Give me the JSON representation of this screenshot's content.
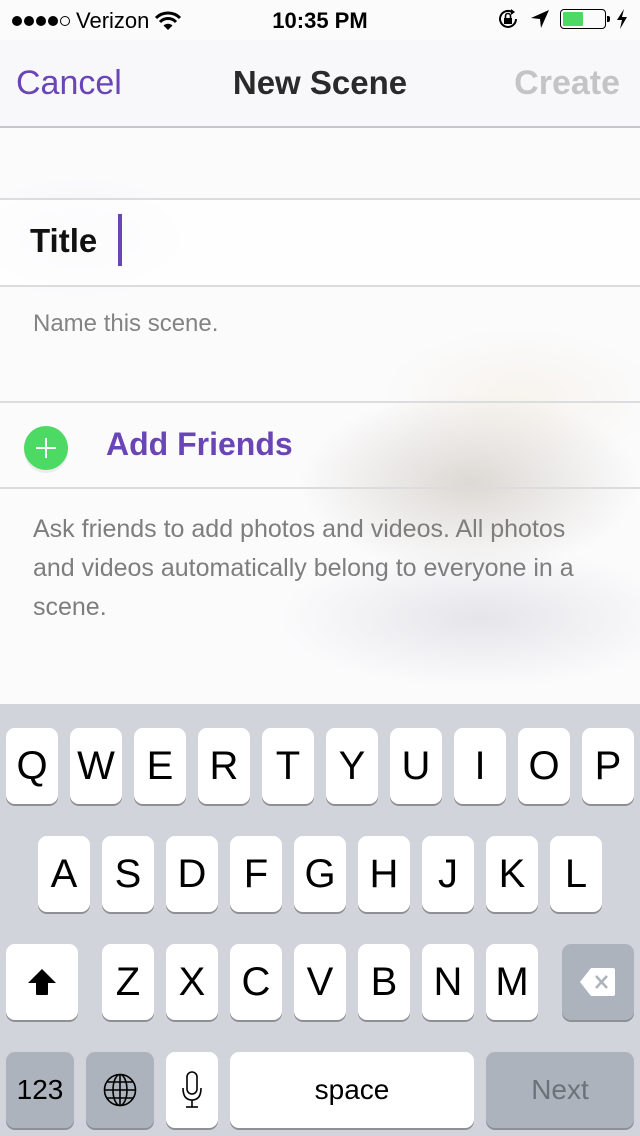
{
  "status_bar": {
    "signal_bars_filled": 4,
    "signal_bars_total": 5,
    "carrier": "Verizon",
    "time": "10:35 PM",
    "battery_level": 0.5,
    "battery_color": "#4cd964",
    "icons": [
      "wifi-icon",
      "rotation-lock-icon",
      "location-arrow-icon",
      "battery-icon",
      "charging-bolt-icon"
    ]
  },
  "navbar": {
    "cancel_label": "Cancel",
    "title": "New Scene",
    "create_label": "Create",
    "accent_color": "#6a45b5"
  },
  "form": {
    "title_label": "Title",
    "title_value": "",
    "title_hint": "Name this scene.",
    "add_friends_label": "Add Friends",
    "add_friends_hint": "Ask friends to add photos and videos. All photos and videos automatically belong to everyone in a scene."
  },
  "keyboard": {
    "row1": [
      "Q",
      "W",
      "E",
      "R",
      "T",
      "Y",
      "U",
      "I",
      "O",
      "P"
    ],
    "row2": [
      "A",
      "S",
      "D",
      "F",
      "G",
      "H",
      "J",
      "K",
      "L"
    ],
    "row3": [
      "Z",
      "X",
      "C",
      "V",
      "B",
      "N",
      "M"
    ],
    "numbers_label": "123",
    "space_label": "space",
    "return_label": "Next"
  }
}
